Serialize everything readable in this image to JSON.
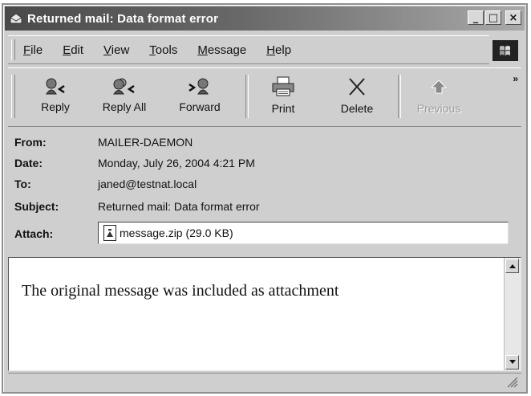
{
  "window": {
    "title": "Returned mail: Data format error",
    "controls": {
      "minimize": "_",
      "maximize": "□",
      "close": "×"
    }
  },
  "menu": {
    "items": [
      {
        "first": "F",
        "rest": "ile"
      },
      {
        "first": "E",
        "rest": "dit"
      },
      {
        "first": "V",
        "rest": "iew"
      },
      {
        "first": "T",
        "rest": "ools"
      },
      {
        "first": "M",
        "rest": "essage"
      },
      {
        "first": "H",
        "rest": "elp"
      }
    ]
  },
  "toolbar": {
    "reply": "Reply",
    "reply_all": "Reply All",
    "forward": "Forward",
    "print": "Print",
    "delete": "Delete",
    "previous": "Previous",
    "more": "»"
  },
  "header": {
    "from_label": "From:",
    "from_value": "MAILER-DAEMON",
    "date_label": "Date:",
    "date_value": "Monday, July 26, 2004 4:21 PM",
    "to_label": "To:",
    "to_value": "janed@testnat.local",
    "subject_label": "Subject:",
    "subject_value": "Returned mail: Data format error",
    "attach_label": "Attach:",
    "attach_value": "message.zip (29.0 KB)"
  },
  "message": {
    "body": "The original message was included as attachment"
  }
}
